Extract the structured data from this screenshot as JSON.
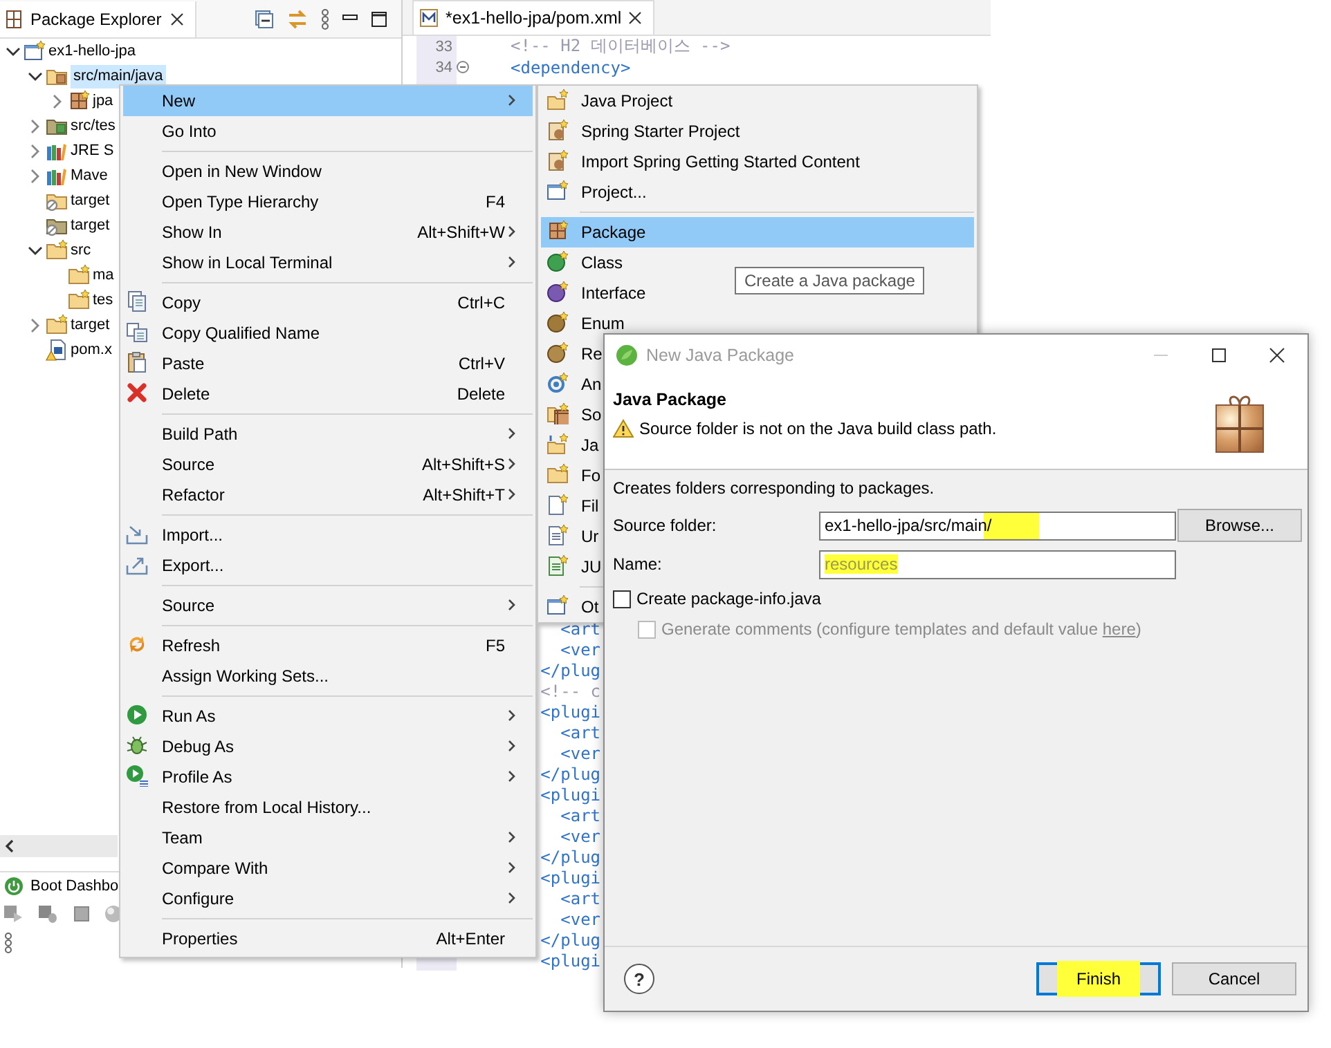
{
  "explorer": {
    "title": "Package Explorer",
    "tree": [
      {
        "label": "ex1-hello-jpa",
        "kind": "project",
        "expanded": true,
        "selected": false,
        "children": [
          {
            "label": "src/main/java",
            "kind": "source",
            "expanded": true,
            "selected": true,
            "children": [
              {
                "label": "jpa",
                "kind": "package",
                "expanded": false,
                "selected": false
              }
            ]
          },
          {
            "label": "src/tes",
            "kind": "test-source",
            "expanded": false,
            "selected": false
          },
          {
            "label": "JRE S",
            "kind": "library",
            "expanded": false,
            "selected": false
          },
          {
            "label": "Mave",
            "kind": "library",
            "expanded": false,
            "selected": false
          },
          {
            "label": "target",
            "kind": "excluded",
            "selected": false
          },
          {
            "label": "target",
            "kind": "excluded-test",
            "selected": false
          },
          {
            "label": "src",
            "kind": "folder",
            "expanded": true,
            "selected": false,
            "children": [
              {
                "label": "ma",
                "kind": "folder",
                "selected": false
              },
              {
                "label": "tes",
                "kind": "folder",
                "selected": false
              }
            ]
          },
          {
            "label": "target",
            "kind": "folder",
            "expanded": false,
            "selected": false
          },
          {
            "label": "pom.x",
            "kind": "maven-file",
            "selected": false
          }
        ]
      }
    ]
  },
  "boot_dashboard": {
    "title": "Boot Dashbo"
  },
  "editor": {
    "tab": {
      "label": "*ex1-hello-jpa/pom.xml"
    },
    "lines": [
      {
        "number": "33",
        "text": "<!-- H2 데이터베이스 -->",
        "kind": "comment",
        "fold": false
      },
      {
        "number": "34",
        "text": "<dependency>",
        "kind": "tag",
        "fold": true
      }
    ],
    "lines_below": [
      {
        "text": "     <art",
        "kind": "tag"
      },
      {
        "text": "     <ver",
        "kind": "tag"
      },
      {
        "text": "   </plug",
        "kind": "tag"
      },
      {
        "text": "   <!-- c",
        "kind": "comment"
      },
      {
        "text": "   <plugi",
        "kind": "tag"
      },
      {
        "text": "     <art",
        "kind": "tag"
      },
      {
        "text": "     <ver",
        "kind": "tag"
      },
      {
        "text": "   </plug",
        "kind": "tag"
      },
      {
        "text": "   <plugi",
        "kind": "tag"
      },
      {
        "text": "     <art",
        "kind": "tag"
      },
      {
        "text": "     <ver",
        "kind": "tag"
      },
      {
        "text": "   </plug",
        "kind": "tag"
      },
      {
        "text": "   <plugi",
        "kind": "tag"
      },
      {
        "text": "     <art",
        "kind": "tag"
      },
      {
        "text": "     <ver",
        "kind": "tag"
      },
      {
        "text": "   </plug",
        "kind": "tag"
      },
      {
        "text": "   <plugi",
        "kind": "tag"
      }
    ]
  },
  "context_menu": {
    "items": [
      {
        "label": "New",
        "kind": "plain",
        "submenu": true,
        "selected": true
      },
      {
        "label": "Go Into",
        "kind": "plain",
        "submenu": false,
        "selected": false
      },
      {
        "kind": "separator"
      },
      {
        "label": "Open in New Window",
        "kind": "plain",
        "submenu": false,
        "selected": false
      },
      {
        "label": "Open Type Hierarchy",
        "shortcut": "F4",
        "kind": "plain",
        "submenu": false,
        "selected": false
      },
      {
        "label": "Show In",
        "shortcut": "Alt+Shift+W",
        "kind": "plain",
        "submenu": true,
        "selected": false
      },
      {
        "label": "Show in Local Terminal",
        "kind": "plain",
        "submenu": true,
        "selected": false
      },
      {
        "kind": "separator"
      },
      {
        "label": "Copy",
        "shortcut": "Ctrl+C",
        "kind": "copy",
        "submenu": false,
        "selected": false
      },
      {
        "label": "Copy Qualified Name",
        "kind": "copy-name",
        "submenu": false,
        "selected": false
      },
      {
        "label": "Paste",
        "shortcut": "Ctrl+V",
        "kind": "paste",
        "submenu": false,
        "selected": false
      },
      {
        "label": "Delete",
        "shortcut": "Delete",
        "kind": "delete",
        "submenu": false,
        "selected": false
      },
      {
        "kind": "separator"
      },
      {
        "label": "Build Path",
        "kind": "plain",
        "submenu": true,
        "selected": false
      },
      {
        "label": "Source",
        "shortcut": "Alt+Shift+S",
        "kind": "plain",
        "submenu": true,
        "selected": false
      },
      {
        "label": "Refactor",
        "shortcut": "Alt+Shift+T",
        "kind": "plain",
        "submenu": true,
        "selected": false
      },
      {
        "kind": "separator"
      },
      {
        "label": "Import...",
        "kind": "import",
        "submenu": false,
        "selected": false
      },
      {
        "label": "Export...",
        "kind": "export",
        "submenu": false,
        "selected": false
      },
      {
        "kind": "separator"
      },
      {
        "label": "Source",
        "kind": "plain",
        "submenu": true,
        "selected": false
      },
      {
        "kind": "separator"
      },
      {
        "label": "Refresh",
        "shortcut": "F5",
        "kind": "refresh",
        "submenu": false,
        "selected": false
      },
      {
        "label": "Assign Working Sets...",
        "kind": "plain",
        "submenu": false,
        "selected": false
      },
      {
        "kind": "separator"
      },
      {
        "label": "Run As",
        "kind": "run",
        "submenu": true,
        "selected": false
      },
      {
        "label": "Debug As",
        "kind": "debug",
        "submenu": true,
        "selected": false
      },
      {
        "label": "Profile As",
        "kind": "profile",
        "submenu": true,
        "selected": false
      },
      {
        "label": "Restore from Local History...",
        "kind": "plain",
        "submenu": false,
        "selected": false
      },
      {
        "label": "Team",
        "kind": "plain",
        "submenu": true,
        "selected": false
      },
      {
        "label": "Compare With",
        "kind": "plain",
        "submenu": true,
        "selected": false
      },
      {
        "label": "Configure",
        "kind": "plain",
        "submenu": true,
        "selected": false
      },
      {
        "kind": "separator"
      },
      {
        "label": "Properties",
        "shortcut": "Alt+Enter",
        "kind": "plain",
        "submenu": false,
        "selected": false
      }
    ]
  },
  "new_submenu": {
    "items": [
      {
        "label": "Java Project",
        "kind": "java-project",
        "selected": false
      },
      {
        "label": "Spring Starter Project",
        "kind": "spring",
        "selected": false
      },
      {
        "label": "Import Spring Getting Started Content",
        "kind": "spring",
        "selected": false
      },
      {
        "label": "Project...",
        "kind": "project",
        "selected": false
      },
      {
        "kind": "separator"
      },
      {
        "label": "Package",
        "kind": "package",
        "selected": true
      },
      {
        "label": "Class",
        "kind": "class",
        "selected": false
      },
      {
        "label": "Interface",
        "kind": "interface",
        "selected": false
      },
      {
        "label": "Enum",
        "kind": "enum",
        "selected": false
      },
      {
        "label": "Re",
        "kind": "record",
        "selected": false
      },
      {
        "label": "An",
        "kind": "annotation",
        "selected": false
      },
      {
        "label": "So",
        "kind": "source-folder",
        "selected": false
      },
      {
        "label": "Ja",
        "kind": "working-set",
        "selected": false
      },
      {
        "label": "Fo",
        "kind": "folder",
        "selected": false
      },
      {
        "label": "Fil",
        "kind": "file",
        "selected": false
      },
      {
        "label": "Ur",
        "kind": "untitled",
        "selected": false
      },
      {
        "label": "JU",
        "kind": "junit",
        "selected": false
      },
      {
        "kind": "separator"
      },
      {
        "label": "Ot",
        "kind": "other",
        "selected": false
      }
    ]
  },
  "tooltip": {
    "text": "Create a Java package"
  },
  "dialog": {
    "title": "New Java Package",
    "heading": "Java Package",
    "warning": "Source folder is not on the Java build class path.",
    "description": "Creates folders corresponding to packages.",
    "fields": [
      {
        "label": "Source folder:",
        "value": "ex1-hello-jpa/src/main/",
        "highlighted": true,
        "button": "Browse..."
      },
      {
        "label": "Name:",
        "value": "resources",
        "highlighted": true
      }
    ],
    "checkboxes": [
      {
        "label": "Create package-info.java",
        "checked": false,
        "disabled": false
      },
      {
        "label": "Generate comments (configure templates and default value ",
        "link": "here",
        "suffix": ")",
        "checked": false,
        "disabled": true
      }
    ],
    "help": "?",
    "buttons": [
      {
        "label": "Finish",
        "kind": "default",
        "highlighted": true
      },
      {
        "label": "Cancel",
        "kind": "normal",
        "highlighted": false
      }
    ]
  }
}
